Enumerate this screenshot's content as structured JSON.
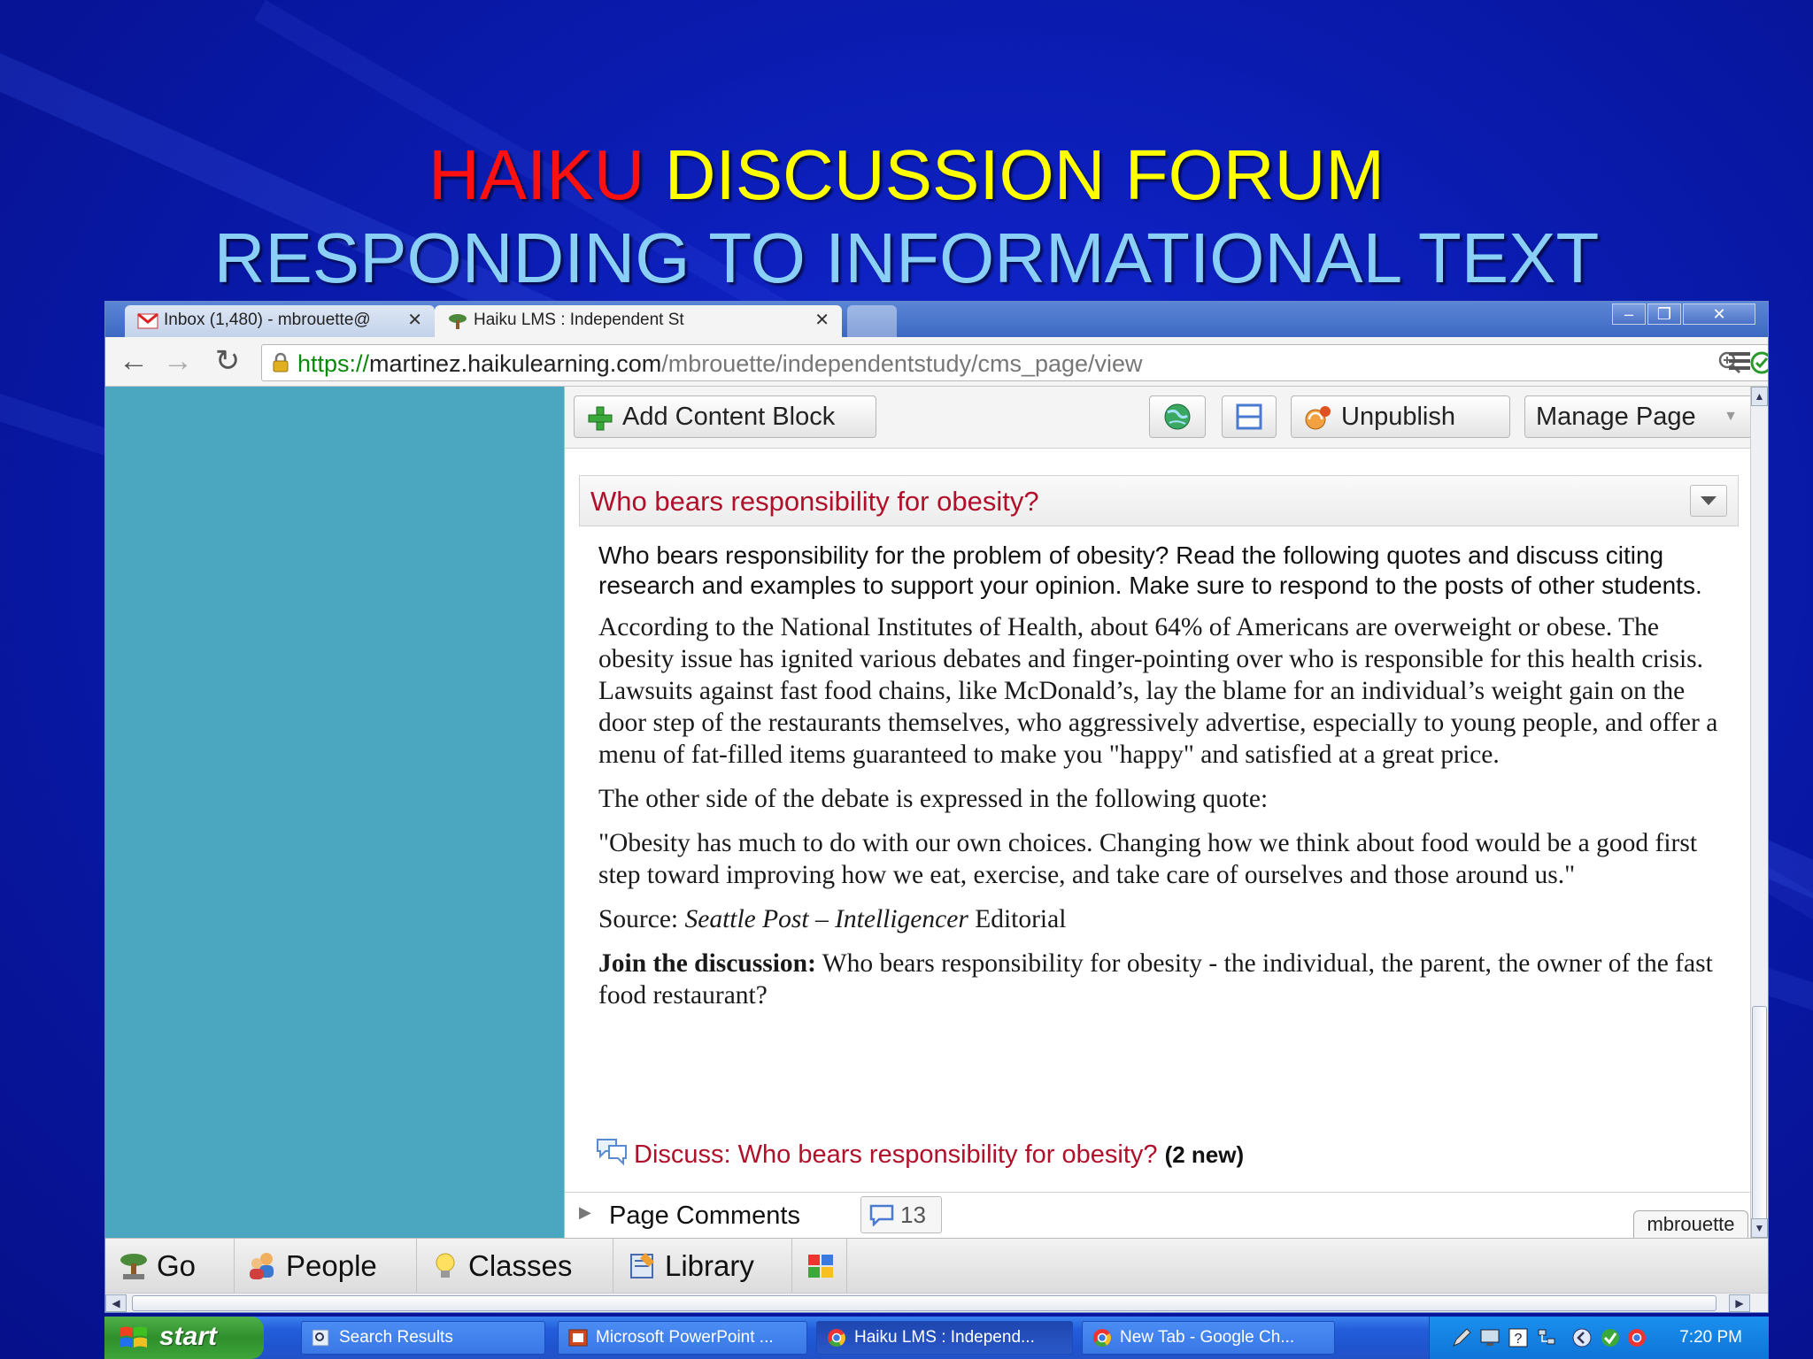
{
  "slide": {
    "title_line1_part1": "HAIKU",
    "title_line1_part2": "DISCUSSION FORUM",
    "title_line2": "RESPONDING TO INFORMATIONAL TEXT",
    "colors": {
      "background": "#0a1cb0",
      "red": "#ff1010",
      "yellow": "#ffff00",
      "light_blue": "#8ad0f6"
    }
  },
  "browser": {
    "tabs": [
      {
        "label": "Inbox (1,480) - mbrouette@",
        "icon": "gmail-icon"
      },
      {
        "label": "Haiku LMS : Independent St",
        "icon": "haiku-tree-icon"
      }
    ],
    "url": {
      "scheme": "https://",
      "host": "martinez.haikulearning.com",
      "path": "/mbrouette/independentstudy/cms_page/view"
    }
  },
  "page_toolbar": {
    "add_content_block": "Add Content Block",
    "unpublish": "Unpublish",
    "manage_page": "Manage Page"
  },
  "block": {
    "title": "Who bears responsibility for obesity?",
    "intro": "Who bears responsibility for the problem of obesity? Read the following quotes and discuss citing research and examples to support your opinion.  Make sure to respond to the posts of other students.",
    "paragraph1": "According to the National Institutes of Health, about 64% of Americans are overweight or obese. The obesity issue has ignited various debates and finger-pointing over who is responsible for this health crisis. Lawsuits against fast food chains, like McDonald’s, lay the blame for an individual’s weight gain on the door step of the restaurants themselves, who aggressively advertise, especially to young people, and offer a menu of fat-filled items guaranteed to make you \"happy\" and satisfied at a great price.",
    "paragraph2": "The other side of the debate is expressed in the following quote:",
    "quote": "\"Obesity has much to do with our own choices. Changing how we think about food would be a good first step toward improving how we eat, exercise, and take care of ourselves and those around us.\"",
    "source_label": "Source:",
    "source_publication": "Seattle Post – Intelligencer",
    "source_suffix": "Editorial",
    "join_label": "Join the discussion:",
    "join_text": "Who bears responsibility for obesity - the individual, the parent, the owner of the fast food restaurant?"
  },
  "discussion": {
    "link_text": "Discuss: Who bears responsibility for obesity?",
    "new_count": "(2 new)"
  },
  "comments": {
    "label": "Page Comments",
    "count": "13",
    "user": "mbrouette"
  },
  "bottom_nav": {
    "go": "Go",
    "people": "People",
    "classes": "Classes",
    "library": "Library"
  },
  "taskbar": {
    "start": "start",
    "tasks": [
      "Search Results",
      "Microsoft PowerPoint ...",
      "Haiku LMS : Independ...",
      "New Tab - Google Ch..."
    ],
    "clock": "7:20 PM"
  }
}
